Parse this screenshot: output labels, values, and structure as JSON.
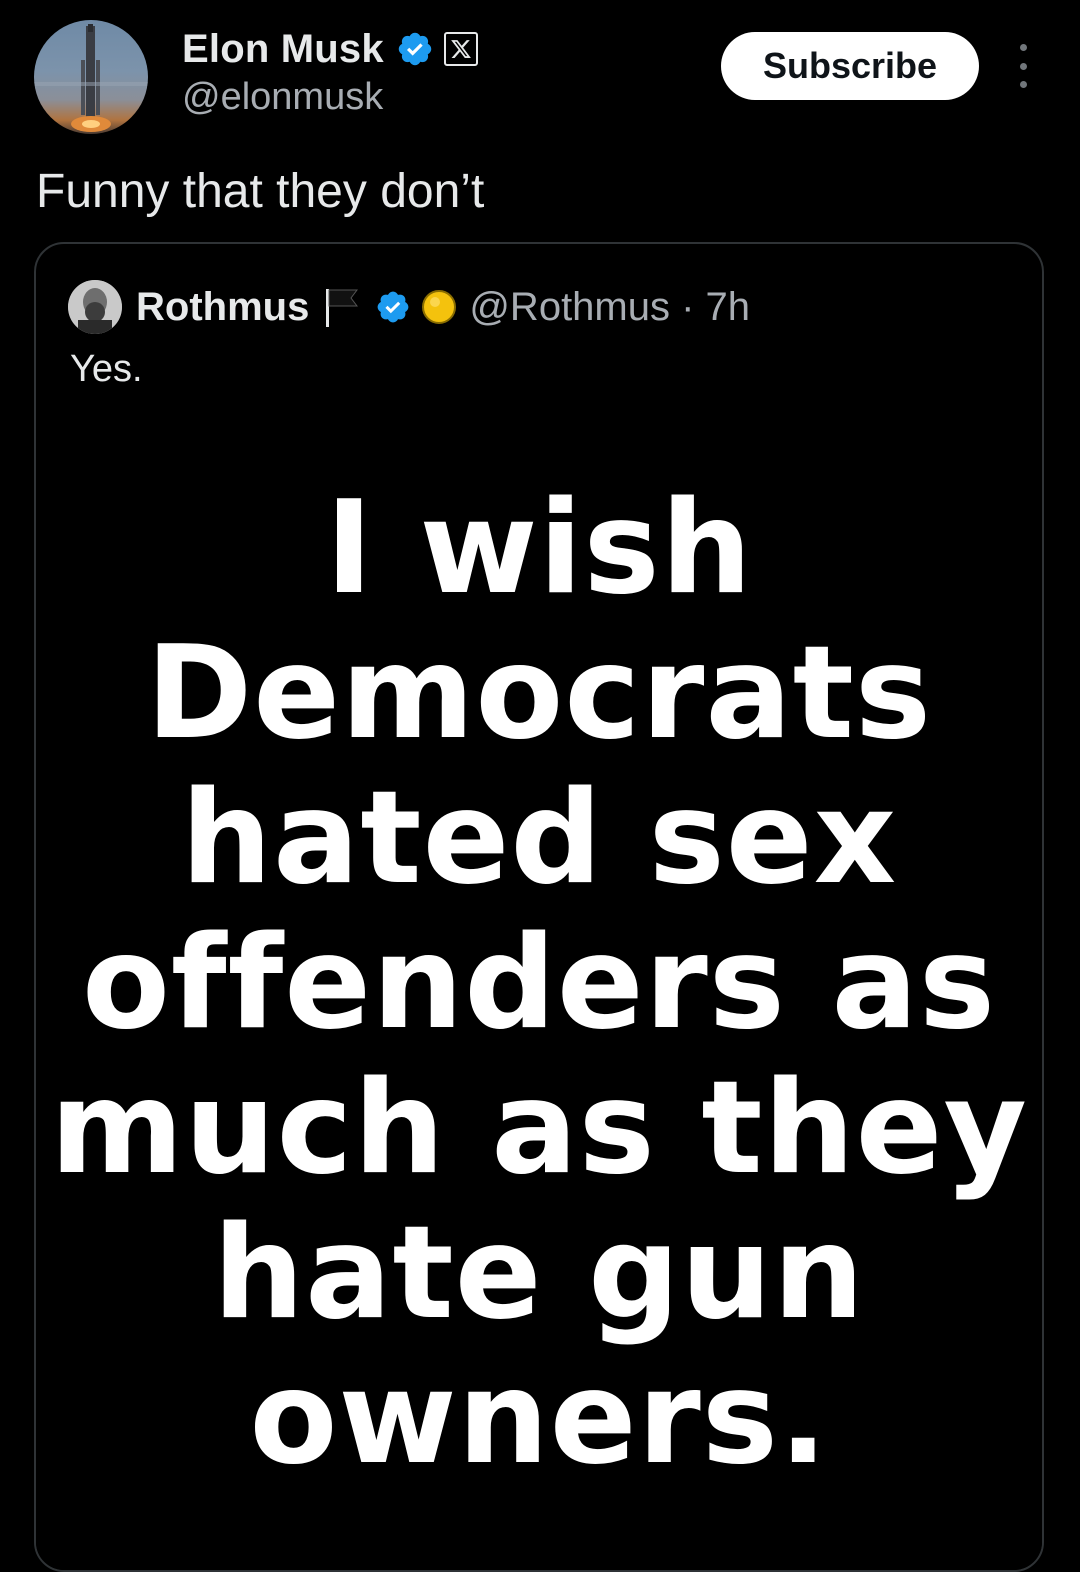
{
  "post": {
    "author": {
      "display_name": "Elon Musk",
      "handle": "@elonmusk"
    },
    "subscribe_label": "Subscribe",
    "text": "Funny that they don’t"
  },
  "quoted_post": {
    "author": {
      "display_name": "Rothmus",
      "handle": "@Rothmus",
      "time": "7h"
    },
    "handle_time": "@Rothmus · 7h",
    "text": "Yes.",
    "image_text": "I wish\nDemocrats\nhated sex\noffenders as\nmuch as they\nhate gun\nowners."
  },
  "colors": {
    "background": "#000000",
    "verified_blue": "#1d9bf0",
    "gold_badge": "#f4c20d",
    "text_primary": "#e7e9ea",
    "text_secondary": "#a8adb3"
  },
  "icons": {
    "verified": "verified-check-badge",
    "affiliation": "x-logo-badge",
    "flag": "black-flag",
    "gold": "gold-circle-badge",
    "more": "vertical-ellipsis"
  }
}
